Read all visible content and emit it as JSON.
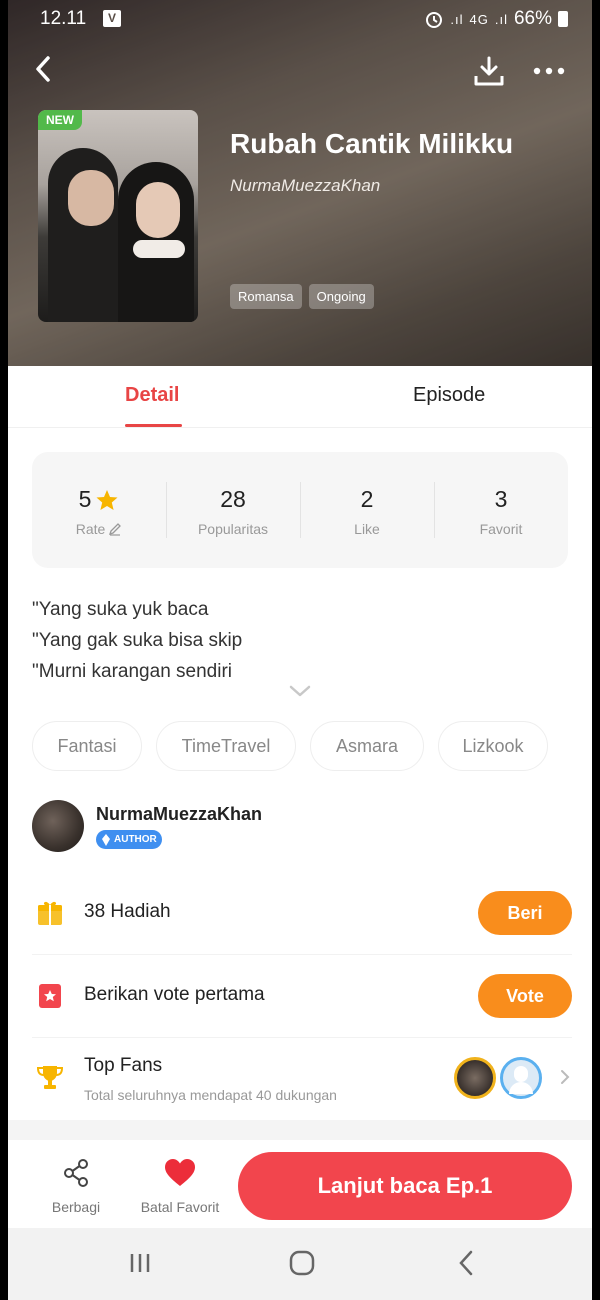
{
  "status_bar": {
    "time": "12.11",
    "app_badge": "V",
    "signal": "4G",
    "battery": "66%"
  },
  "book": {
    "title": "Rubah Cantik Milikku",
    "author": "NurmaMuezzaKhan",
    "new_badge": "NEW",
    "tags": [
      "Romansa",
      "Ongoing"
    ]
  },
  "tabs": {
    "detail": "Detail",
    "episode": "Episode"
  },
  "stats": {
    "rate": {
      "value": "5",
      "label": "Rate"
    },
    "popularity": {
      "value": "28",
      "label": "Popularitas"
    },
    "like": {
      "value": "2",
      "label": "Like"
    },
    "favorite": {
      "value": "3",
      "label": "Favorit"
    }
  },
  "description": [
    "\"Yang suka yuk baca",
    "\"Yang gak suka bisa skip",
    "\"Murni karangan sendiri"
  ],
  "genres": [
    "Fantasi",
    "TimeTravel",
    "Asmara",
    "Lizkook"
  ],
  "author_row": {
    "name": "NurmaMuezzaKhan",
    "badge": "AUTHOR"
  },
  "gift_row": {
    "text": "38 Hadiah",
    "button": "Beri"
  },
  "vote_row": {
    "text": "Berikan vote pertama",
    "button": "Vote"
  },
  "fans_row": {
    "title": "Top Fans",
    "subtitle": "Total seluruhnya mendapat 40 dukungan"
  },
  "bottom_bar": {
    "share": "Berbagi",
    "unfavorite": "Batal Favorit",
    "cta": "Lanjut baca Ep.1"
  },
  "colors": {
    "accent": "#e84545",
    "orange": "#f98d1c",
    "cta": "#f2454d",
    "new_badge": "#52b94a"
  },
  "icons": [
    "back-icon",
    "download-icon",
    "more-icon",
    "star-icon",
    "edit-icon",
    "chevron-down-icon",
    "gift-icon",
    "vote-icon",
    "trophy-icon",
    "share-icon",
    "heart-icon"
  ]
}
